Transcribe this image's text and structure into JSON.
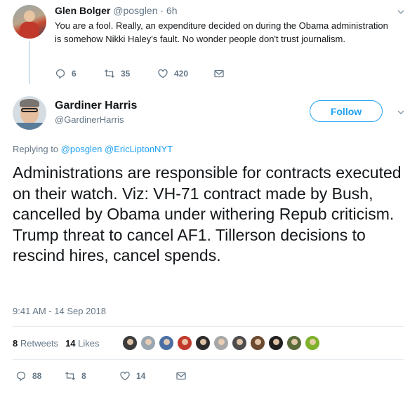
{
  "reply_tweet": {
    "name": "Glen Bolger",
    "handle": "@posglen",
    "separator": "·",
    "time": "6h",
    "text": "You are a fool. Really, an expenditure decided on during the Obama administration is somehow Nikki Haley's fault.  No wonder people don't trust journalism.",
    "actions": {
      "replies": "6",
      "retweets": "35",
      "likes": "420"
    }
  },
  "main_tweet": {
    "name": "Gardiner Harris",
    "handle": "@GardinerHarris",
    "follow_label": "Follow",
    "replying_prefix": "Replying to",
    "replying_to": [
      "@posglen",
      "@EricLiptonNYT"
    ],
    "text": "Administrations are responsible for contracts executed on their watch. Viz: VH-71 contract made by Bush, cancelled by Obama under withering Repub criticism. Trump threat to cancel AF1. Tillerson decisions to rescind hires, cancel spends.",
    "timestamp": "9:41 AM - 14 Sep 2018",
    "stats": {
      "retweets_count": "8",
      "retweets_label": "Retweets",
      "likes_count": "14",
      "likes_label": "Likes"
    },
    "liker_colors": [
      "#3b3b3b",
      "#9aa6b2",
      "#4a6fa5",
      "#c0392b",
      "#2c2c2c",
      "#a8a8a8",
      "#4d4d4d",
      "#6b4a2f",
      "#1f1f1f",
      "#5a6b3a",
      "#7fb12a"
    ],
    "actions": {
      "replies": "88",
      "retweets": "8",
      "likes": "14"
    }
  },
  "colors": {
    "accent": "#1da1f2",
    "text": "#14171a",
    "muted": "#657786",
    "divider": "#e6ecf0",
    "thread_line": "#cfe1ee"
  }
}
